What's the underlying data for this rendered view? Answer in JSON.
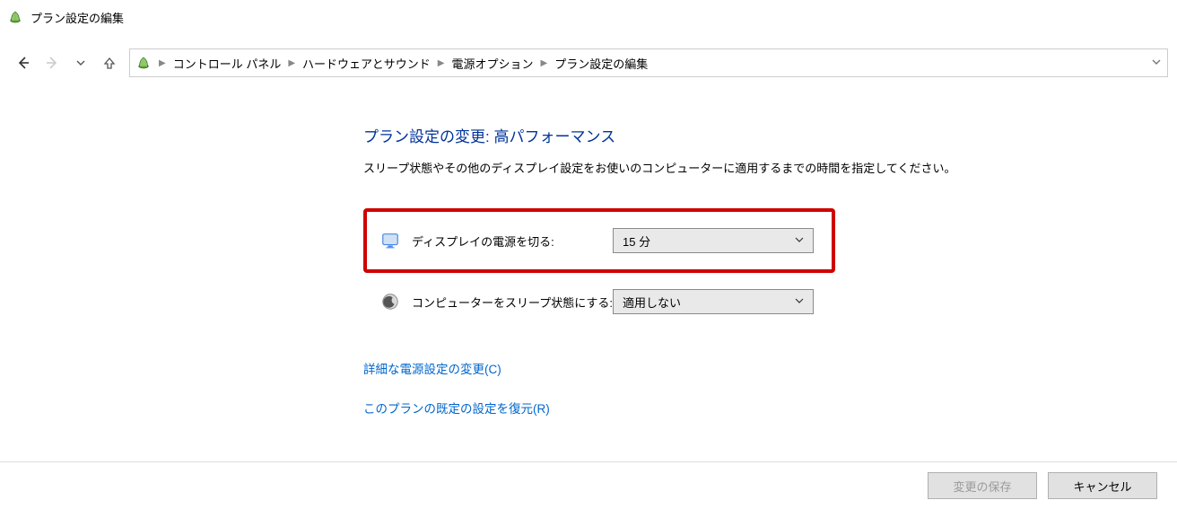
{
  "window": {
    "title": "プラン設定の編集"
  },
  "breadcrumb": {
    "items": [
      "コントロール パネル",
      "ハードウェアとサウンド",
      "電源オプション",
      "プラン設定の編集"
    ]
  },
  "page": {
    "heading": "プラン設定の変更: 高パフォーマンス",
    "subheading": "スリープ状態やその他のディスプレイ設定をお使いのコンピューターに適用するまでの時間を指定してください。"
  },
  "settings": {
    "display_off": {
      "label": "ディスプレイの電源を切る:",
      "value": "15 分"
    },
    "sleep": {
      "label": "コンピューターをスリープ状態にする:",
      "value": "適用しない"
    }
  },
  "links": {
    "advanced": "詳細な電源設定の変更(C)",
    "restore_defaults": "このプランの既定の設定を復元(R)"
  },
  "buttons": {
    "save": "変更の保存",
    "cancel": "キャンセル"
  }
}
